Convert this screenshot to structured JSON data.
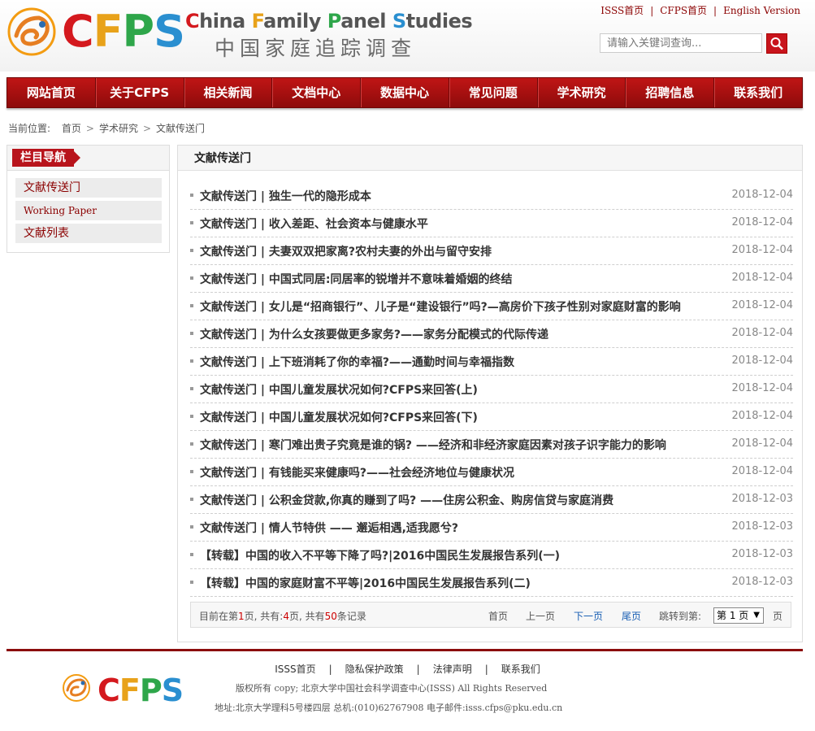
{
  "header": {
    "logo_text": "CFPS",
    "title_en": "China Family Panel Studies",
    "title_zh": "中国家庭追踪调查",
    "top_links": [
      "ISSS首页",
      "CFPS首页",
      "English Version"
    ],
    "search": {
      "placeholder": "请输入关键词查询..."
    }
  },
  "nav": {
    "items": [
      "网站首页",
      "关于CFPS",
      "相关新闻",
      "文档中心",
      "数据中心",
      "常见问题",
      "学术研究",
      "招聘信息",
      "联系我们"
    ]
  },
  "breadcrumb": {
    "prefix": "当前位置:",
    "items": [
      "首页",
      "学术研究",
      "文献传送门"
    ]
  },
  "sidebar": {
    "title": "栏目导航",
    "items": [
      "文献传送门",
      "Working Paper",
      "文献列表"
    ]
  },
  "main": {
    "title": "文献传送门",
    "rows": [
      {
        "title": "文献传送门 | 独生一代的隐形成本",
        "date": "2018-12-04"
      },
      {
        "title": "文献传送门 | 收入差距、社会资本与健康水平",
        "date": "2018-12-04"
      },
      {
        "title": "文献传送门 | 夫妻双双把家离?农村夫妻的外出与留守安排",
        "date": "2018-12-04"
      },
      {
        "title": "文献传送门 | 中国式同居:同居率的锐增并不意味着婚姻的终结",
        "date": "2018-12-04"
      },
      {
        "title": "文献传送门 | 女儿是“招商银行”、儿子是“建设银行”吗?—高房价下孩子性别对家庭财富的影响",
        "date": "2018-12-04"
      },
      {
        "title": "文献传送门 | 为什么女孩要做更多家务?——家务分配模式的代际传递",
        "date": "2018-12-04"
      },
      {
        "title": "文献传送门 | 上下班消耗了你的幸福?——通勤时间与幸福指数",
        "date": "2018-12-04"
      },
      {
        "title": "文献传送门 | 中国儿童发展状况如何?CFPS来回答(上)",
        "date": "2018-12-04"
      },
      {
        "title": "文献传送门 | 中国儿童发展状况如何?CFPS来回答(下)",
        "date": "2018-12-04"
      },
      {
        "title": "文献传送门 | 寒门难出贵子究竟是谁的锅? ——经济和非经济家庭因素对孩子识字能力的影响",
        "date": "2018-12-04"
      },
      {
        "title": "文献传送门 | 有钱能买来健康吗?——社会经济地位与健康状况",
        "date": "2018-12-04"
      },
      {
        "title": "文献传送门 | 公积金贷款,你真的赚到了吗? ——住房公积金、购房信贷与家庭消费",
        "date": "2018-12-03"
      },
      {
        "title": "文献传送门 | 情人节特供 —— 邂逅相遇,适我愿兮?",
        "date": "2018-12-03"
      },
      {
        "title": "【转载】中国的收入不平等下降了吗?|2016中国民生发展报告系列(一)",
        "date": "2018-12-03"
      },
      {
        "title": "【转载】中国的家庭财富不平等|2016中国民生发展报告系列(二)",
        "date": "2018-12-03"
      }
    ]
  },
  "pager": {
    "text_a": "目前在第",
    "current": "1",
    "text_b": "页, 共有:",
    "total_pages": "4",
    "text_c": "页, 共有",
    "total_records": "50",
    "text_d": "条记录",
    "first": "首页",
    "prev": "上一页",
    "next": "下一页",
    "last": "尾页",
    "jump_label": "跳转到第:",
    "jump_value": "第 1 页",
    "jump_suffix": "页"
  },
  "footer": {
    "links": [
      "ISSS首页",
      "隐私保护政策",
      "法律声明",
      "联系我们"
    ],
    "copyright": "版权所有 copy; 北京大学中国社会科学调查中心(ISSS) All Rights Reserved",
    "address": "地址:北京大学理科5号楼四层 总机:(010)62767908 电子邮件:isss.cfps@pku.edu.cn"
  },
  "colors": {
    "brand_red": "#b8141c",
    "nav_dark": "#8d0b0b",
    "link_blue": "#1a5fb4"
  }
}
